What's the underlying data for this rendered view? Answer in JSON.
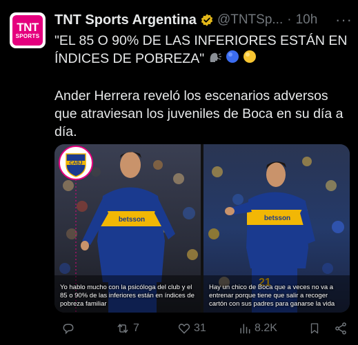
{
  "tweet": {
    "author_name": "TNT Sports Argentina",
    "handle": "@TNTSp...",
    "separator": "·",
    "time": "10h",
    "more": "···",
    "avatar_line1": "TNT",
    "avatar_line2": "SPORTS",
    "text_line1": "\"EL 85 O 90% DE LAS INFERIORES ESTÁN EN ÍNDICES DE POBREZA\"",
    "text_line2": "Ander Herrera reveló los escenarios adversos que atraviesan los juveniles de Boca en su día a día.",
    "emojis": [
      "speaking-head-icon",
      "blue-circle-icon",
      "yellow-circle-icon"
    ]
  },
  "media": {
    "left_caption": "Yo hablo mucho con la psicóloga del club y el 85 o 90% de las inferiores están en índices de pobreza familiar",
    "right_caption": "Hay un chico de Boca que a veces no va a entrenar porque tiene que salir a recoger cartón con sus padres para ganarse la vida",
    "crest_text": "CABJ",
    "sponsor_text": "betsson"
  },
  "actions": {
    "retweets": "7",
    "likes": "31",
    "views": "8.2K"
  },
  "colors": {
    "background": "#000000",
    "text": "#e7e9ea",
    "muted": "#71767b",
    "brand": "#e5007e",
    "boca_blue": "#1a3a8f",
    "boca_gold": "#f2b705"
  }
}
